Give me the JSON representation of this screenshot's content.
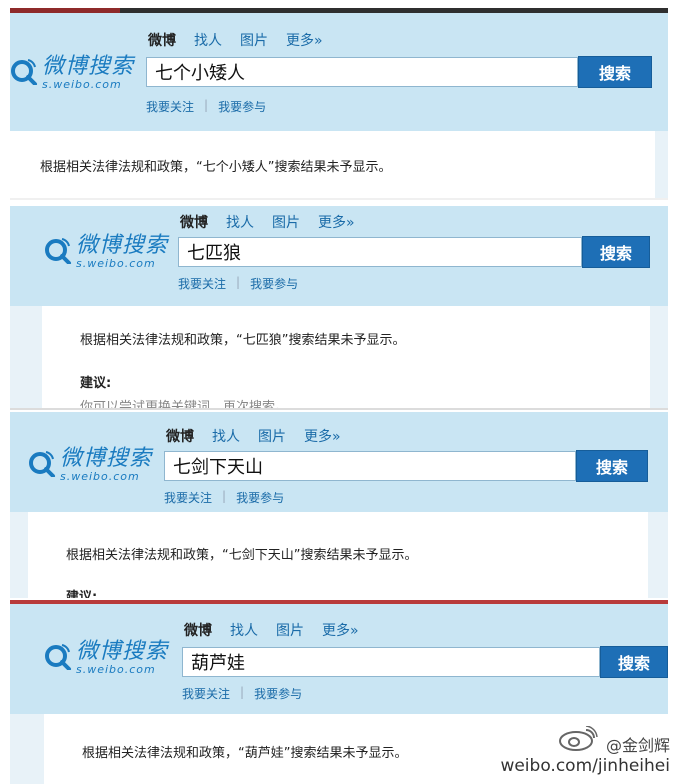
{
  "panels": [
    {
      "tabs": [
        "微博",
        "找人",
        "图片",
        "更多»"
      ],
      "query": "七个小矮人",
      "button": "搜索",
      "links": [
        "我要关注",
        "我要参与"
      ],
      "message": "根据相关法律法规和政策，“七个小矮人”搜索结果未予显示。"
    },
    {
      "tabs": [
        "微博",
        "找人",
        "图片",
        "更多»"
      ],
      "query": "七匹狼",
      "button": "搜索",
      "links": [
        "我要关注",
        "我要参与"
      ],
      "message": "根据相关法律法规和政策，“七匹狼”搜索结果未予显示。",
      "suggest_title": "建议:",
      "suggest_text": "你可以尝试更换关键词，再次搜索。"
    },
    {
      "tabs": [
        "微博",
        "找人",
        "图片",
        "更多»"
      ],
      "query": "七剑下天山",
      "button": "搜索",
      "links": [
        "我要关注",
        "我要参与"
      ],
      "message": "根据相关法律法规和政策，“七剑下天山”搜索结果未予显示。",
      "suggest_title": "建议:"
    },
    {
      "tabs": [
        "微博",
        "找人",
        "图片",
        "更多»"
      ],
      "query": "葫芦娃",
      "button": "搜索",
      "links": [
        "我要关注",
        "我要参与"
      ],
      "message": "根据相关法律法规和政策，“葫芦娃”搜索结果未予显示。"
    }
  ],
  "logo": {
    "cn": "微博搜索",
    "url": "s.weibo.com"
  },
  "watermark": {
    "handle": "@金剑辉",
    "site": "weibo.com/jinheihei"
  },
  "colors": {
    "header_bg": "#c9e5f3",
    "button_bg": "#1e6fb6",
    "link": "#1a6ba8"
  }
}
